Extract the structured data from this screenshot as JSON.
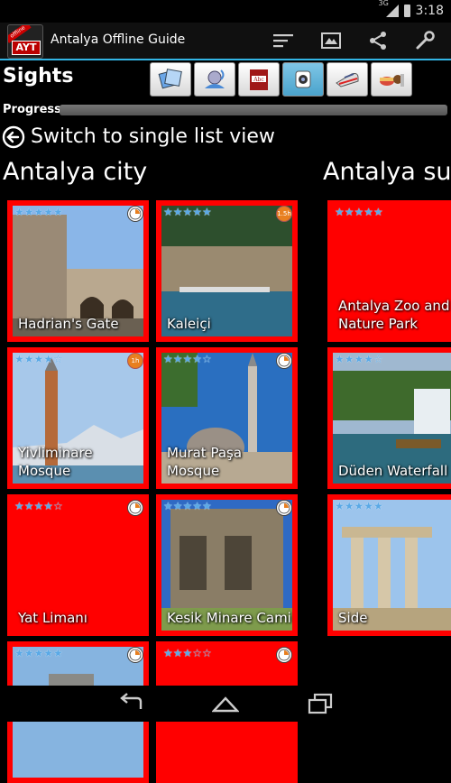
{
  "status": {
    "network": "3G",
    "time": "3:18"
  },
  "app": {
    "title": "Antalya Offline Guide",
    "logo_text": "AYT",
    "logo_ribbon": "offline"
  },
  "actions": [
    "list-icon",
    "map-icon",
    "share-icon",
    "wrench-icon"
  ],
  "header": {
    "title": "Sights"
  },
  "categories": [
    "sights-icon",
    "radio-tower-icon",
    "dictionary-icon",
    "camera-icon",
    "train-icon",
    "food-icon"
  ],
  "progress": {
    "label": "Progress",
    "value": 0
  },
  "switch": {
    "label": "Switch to single list view"
  },
  "sections": [
    {
      "title": "Antalya city",
      "tiles": [
        {
          "name": "Hadrian's Gate",
          "stars": 5,
          "badge": "clock"
        },
        {
          "name": "Kaleiçi",
          "stars": 5,
          "badge": "1.5h"
        },
        {
          "name": "Yivliminare Mosque",
          "stars": 4,
          "badge": "1h"
        },
        {
          "name": "Murat Paşa Mosque",
          "stars": 4,
          "badge": "clock"
        },
        {
          "name": "Yat Limanı",
          "stars": 4,
          "badge": "clock"
        },
        {
          "name": "Kesik Minare Cami",
          "stars": 5,
          "badge": "clock"
        },
        {
          "name": "",
          "stars": 5,
          "badge": "clock"
        },
        {
          "name": "",
          "stars": 3,
          "badge": "clock"
        }
      ]
    },
    {
      "title": "Antalya su",
      "tiles": [
        {
          "name": "Antalya Zoo and Nature Park",
          "stars": 5
        },
        {
          "name": "Düden Waterfall",
          "stars": 4
        },
        {
          "name": "Side",
          "stars": 5
        }
      ]
    }
  ],
  "nav": [
    "back-icon",
    "home-icon",
    "recents-icon"
  ],
  "colors": {
    "tile": "#ff0000",
    "accent": "#33b5e5",
    "star": "#5aa9e6"
  }
}
